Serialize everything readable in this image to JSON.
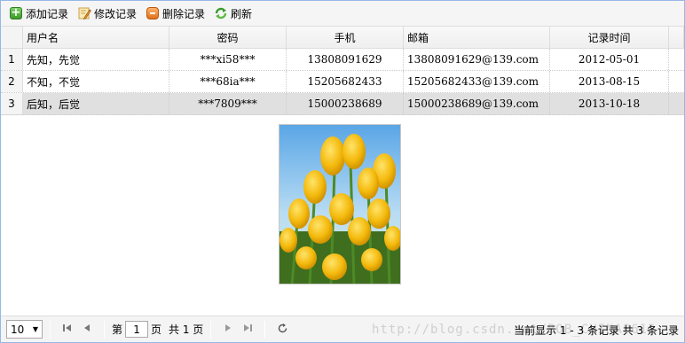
{
  "toolbar": {
    "add_label": "添加记录",
    "edit_label": "修改记录",
    "delete_label": "删除记录",
    "refresh_label": "刷新"
  },
  "grid": {
    "columns": [
      "用户名",
      "密码",
      "手机",
      "邮箱",
      "记录时间"
    ],
    "rows": [
      {
        "num": "1",
        "username": "先知，先觉",
        "password": "***xi58***",
        "phone": "13808091629",
        "email": "13808091629@139.com",
        "time": "2012-05-01"
      },
      {
        "num": "2",
        "username": "不知，不觉",
        "password": "***68ia***",
        "phone": "15205682433",
        "email": "15205682433@139.com",
        "time": "2013-08-15"
      },
      {
        "num": "3",
        "username": "后知，后觉",
        "password": "***7809***",
        "phone": "15000238689",
        "email": "15000238689@139.com",
        "time": "2013-10-18",
        "selected": true
      }
    ]
  },
  "pager": {
    "page_size": "10",
    "page_prefix": "第",
    "page_value": "1",
    "page_suffix": "页",
    "total_pages": "共 1 页",
    "info": "当前显示 1 - 3 条记录  共 3 条记录",
    "watermark": "http://blog.csdn.net/BOB_CHINA8612"
  },
  "colors": {
    "border": "#95b8e7",
    "selected_row": "#e0e0e0",
    "toolbar_bg": "#f5f5f5"
  },
  "icons": [
    "add-icon",
    "edit-icon",
    "delete-icon",
    "refresh-icon",
    "first-page-icon",
    "prev-page-icon",
    "next-page-icon",
    "last-page-icon",
    "reload-icon",
    "chevron-down-icon"
  ]
}
